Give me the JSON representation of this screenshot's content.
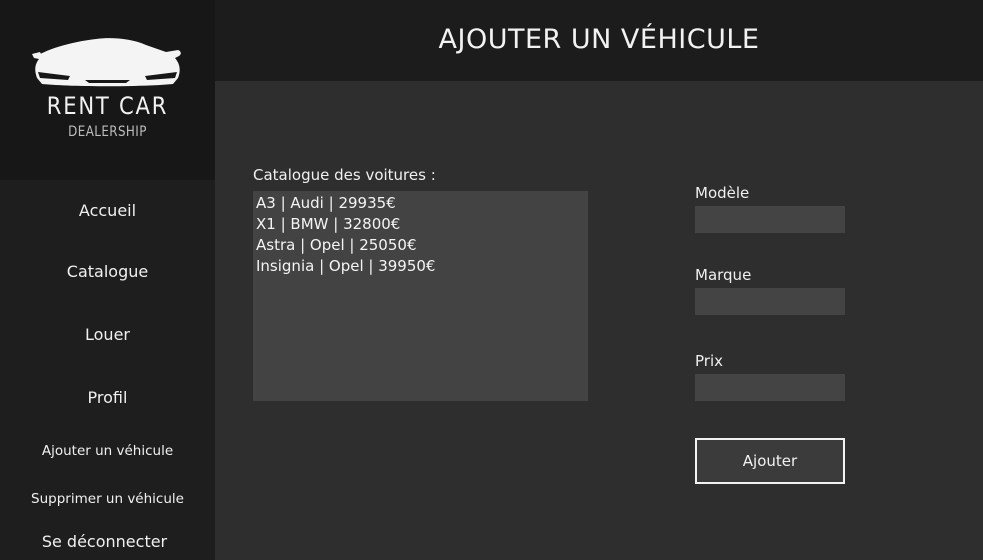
{
  "logo": {
    "title": "RENT CAR",
    "subtitle": "DEALERSHIP"
  },
  "sidebar": {
    "items": [
      {
        "label": "Accueil"
      },
      {
        "label": "Catalogue"
      },
      {
        "label": "Louer"
      },
      {
        "label": "Profil"
      },
      {
        "label": "Ajouter un véhicule"
      },
      {
        "label": "Supprimer un véhicule"
      },
      {
        "label": "Se déconnecter"
      }
    ]
  },
  "header": {
    "title": "AJOUTER UN VÉHICULE"
  },
  "catalog": {
    "label": "Catalogue des voitures :",
    "items": [
      "A3 | Audi | 29935€",
      "X1 | BMW | 32800€",
      "Astra | Opel | 25050€",
      "Insignia | Opel | 39950€"
    ]
  },
  "form": {
    "model_label": "Modèle",
    "model_value": "",
    "brand_label": "Marque",
    "brand_value": "",
    "price_label": "Prix",
    "price_value": "",
    "submit_label": "Ajouter"
  },
  "colors": {
    "sidebar_bg": "#1e1e1e",
    "header_bg": "#1c1c1c",
    "main_bg": "#2e2e2e",
    "input_bg": "#444444"
  }
}
